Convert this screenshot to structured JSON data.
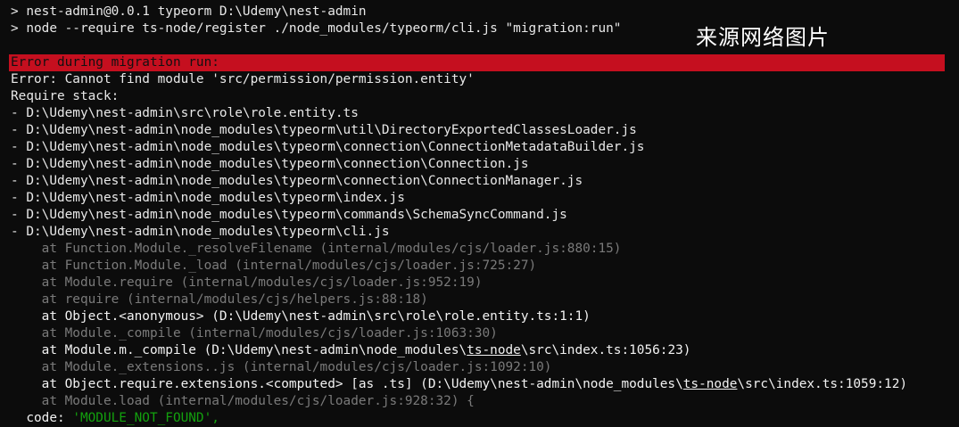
{
  "watermark": "来源网络图片",
  "header": {
    "line1": "> nest-admin@0.0.1 typeorm D:\\Udemy\\nest-admin",
    "line2": "> node --require ts-node/register ./node_modules/typeorm/cli.js \"migration:run\""
  },
  "error": {
    "highlight": "Error during migration run:",
    "message": "Error: Cannot find module 'src/permission/permission.entity'",
    "stack_title": "Require stack:"
  },
  "require_stack": [
    "- D:\\Udemy\\nest-admin\\src\\role\\role.entity.ts",
    "- D:\\Udemy\\nest-admin\\node_modules\\typeorm\\util\\DirectoryExportedClassesLoader.js",
    "- D:\\Udemy\\nest-admin\\node_modules\\typeorm\\connection\\ConnectionMetadataBuilder.js",
    "- D:\\Udemy\\nest-admin\\node_modules\\typeorm\\connection\\Connection.js",
    "- D:\\Udemy\\nest-admin\\node_modules\\typeorm\\connection\\ConnectionManager.js",
    "- D:\\Udemy\\nest-admin\\node_modules\\typeorm\\index.js",
    "- D:\\Udemy\\nest-admin\\node_modules\\typeorm\\commands\\SchemaSyncCommand.js",
    "- D:\\Udemy\\nest-admin\\node_modules\\typeorm\\cli.js"
  ],
  "trace": {
    "t1": "    at Function.Module._resolveFilename (internal/modules/cjs/loader.js:880:15)",
    "t2": "    at Function.Module._load (internal/modules/cjs/loader.js:725:27)",
    "t3": "    at Module.require (internal/modules/cjs/loader.js:952:19)",
    "t4": "    at require (internal/modules/cjs/helpers.js:88:18)",
    "t5": "    at Object.<anonymous> (D:\\Udemy\\nest-admin\\src\\role\\role.entity.ts:1:1)",
    "t6": "    at Module._compile (internal/modules/cjs/loader.js:1063:30)",
    "t7_pre": "    at Module.m._compile (D:\\Udemy\\nest-admin\\node_modules\\",
    "t7_link": "ts-node",
    "t7_post": "\\src\\index.ts:1056:23)",
    "t8": "    at Module._extensions..js (internal/modules/cjs/loader.js:1092:10)",
    "t9_pre": "    at Object.require.extensions.<computed> [as .ts] (D:\\Udemy\\nest-admin\\node_modules\\",
    "t9_link": "ts-node",
    "t9_post": "\\src\\index.ts:1059:12)",
    "t10": "    at Module.load (internal/modules/cjs/loader.js:928:32) {",
    "t11_pre": "  code: ",
    "t11_val": "'MODULE_NOT_FOUND',"
  },
  "colors": {
    "error_bar": "#c50f1f",
    "background": "#0c0c0c",
    "dim_text": "#7a7a7a",
    "green": "#13a10e"
  }
}
